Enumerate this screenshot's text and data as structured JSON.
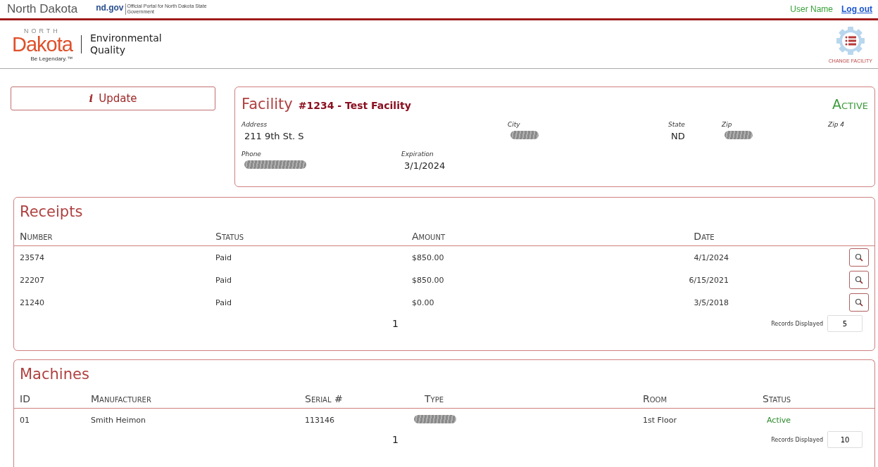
{
  "top_bar": {
    "state_name": "North Dakota",
    "portal_domain": "nd.gov",
    "portal_caption": "Official Portal for North Dakota State Government",
    "user_name": "User Name",
    "logout": "Log out"
  },
  "header": {
    "logo_small": "NORTH",
    "logo_big": "Dakota",
    "logo_tagline": "Be Legendary.™",
    "department": "Environmental Quality",
    "change_facility": "CHANGE FACILITY"
  },
  "update_button": {
    "icon": "i",
    "label": "Update"
  },
  "facility": {
    "title": "Facility",
    "name": "#1234 - Test Facility",
    "status": "Active",
    "fields": [
      {
        "label": "Address",
        "value": "211 9th St. S",
        "redacted": false
      },
      {
        "label": "City",
        "redacted": true
      },
      {
        "label": "State",
        "value": "ND",
        "redacted": false
      },
      {
        "label": "Zip",
        "redacted": true
      },
      {
        "label": "Zip 4",
        "redacted": false
      },
      {
        "label": "Phone",
        "redacted": true
      },
      {
        "label": "Expiration",
        "value": "3/1/2024",
        "redacted": false
      }
    ]
  },
  "receipts": {
    "title": "Receipts",
    "columns": [
      "Number",
      "Status",
      "Amount",
      "Date"
    ],
    "rows": [
      {
        "cells": [
          "23574",
          "Paid",
          "$850.00",
          "4/1/2024"
        ]
      },
      {
        "cells": [
          "22207",
          "Paid",
          "$850.00",
          "6/15/2021"
        ]
      },
      {
        "cells": [
          "21240",
          "Paid",
          "$0.00",
          "3/5/2018"
        ]
      }
    ],
    "page": "1",
    "records_label": "Records Displayed",
    "records_value": "5"
  },
  "machines": {
    "title": "Machines",
    "columns": [
      "ID",
      "Manufacturer",
      "Serial #",
      "Type",
      "Room",
      "Status"
    ],
    "rows": [
      {
        "cells": [
          "01",
          "Smith Heimon",
          "113146",
          null,
          "1st Floor",
          "Active"
        ]
      }
    ],
    "page": "1",
    "records_label": "Records Displayed",
    "records_value": "10"
  }
}
